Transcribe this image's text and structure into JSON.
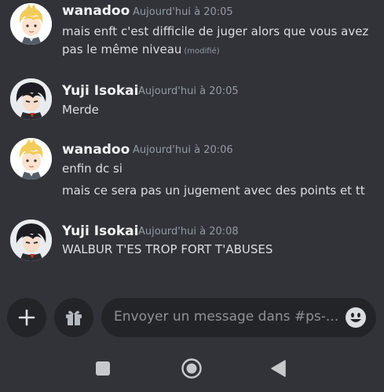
{
  "messages": [
    {
      "author": "wanadoo",
      "time": "Aujourd'hui à 20:05",
      "lines": [
        "mais enft c'est difficile de juger alors que vous avez",
        "pas le même niveau"
      ],
      "edited": "(modifié)"
    },
    {
      "author": "Yuji Isokai",
      "time": "Aujourd'hui à 20:05",
      "lines": [
        "Merde"
      ]
    },
    {
      "author": "wanadoo",
      "time": "Aujourd'hui à 20:06",
      "lines": [
        "enfin dc si",
        "mais ce sera pas un jugement avec des points et tt"
      ]
    },
    {
      "author": "Yuji Isokai",
      "time": "Aujourd'hui à 20:08",
      "lines": [
        "WALBUR T'ES TROP FORT T'ABUSES"
      ]
    }
  ],
  "composer": {
    "placeholder": "Envoyer un message dans #ps-..."
  },
  "icons": {
    "add": "plus-icon",
    "gift": "gift-icon",
    "emoji": "emoji-icon",
    "nav_recents": "square-icon",
    "nav_home": "circle-icon",
    "nav_back": "back-triangle-icon"
  },
  "colors": {
    "background": "#313338",
    "input_background": "#232428",
    "author": "#f2f3f5",
    "timestamp": "#949ba4"
  }
}
